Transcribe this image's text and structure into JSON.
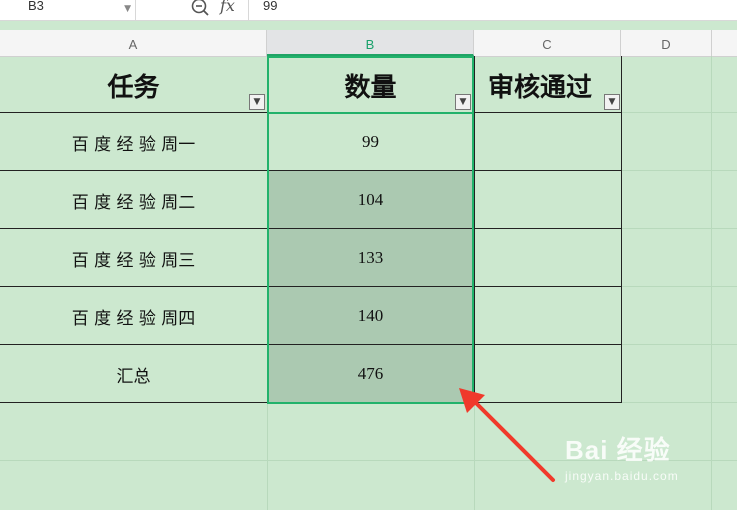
{
  "formula_bar": {
    "cell_reference": "B3",
    "formula_value": "99"
  },
  "columns": [
    "A",
    "B",
    "C",
    "D"
  ],
  "table": {
    "headers": [
      "任务",
      "数量",
      "审核通过"
    ],
    "rows": [
      {
        "task": "百 度 经 验  周一",
        "count": "99",
        "approved": ""
      },
      {
        "task": "百 度 经 验  周二",
        "count": "104",
        "approved": ""
      },
      {
        "task": "百 度 经 验  周三",
        "count": "133",
        "approved": ""
      },
      {
        "task": "百 度 经 验  周四",
        "count": "140",
        "approved": ""
      },
      {
        "task": "汇总",
        "count": "476",
        "approved": ""
      }
    ]
  },
  "watermark": {
    "logo": "Bai 经验",
    "url": "jingyan.baidu.com"
  },
  "colors": {
    "sheet_background": "#cce8cf",
    "selection_border": "#21b26b",
    "selection_fill": "#abc9b1",
    "arrow": "#f0392b"
  },
  "icons": [
    "zoom-icon",
    "fx-icon",
    "filter-dropdown-icon",
    "dropdown-arrow-icon"
  ]
}
